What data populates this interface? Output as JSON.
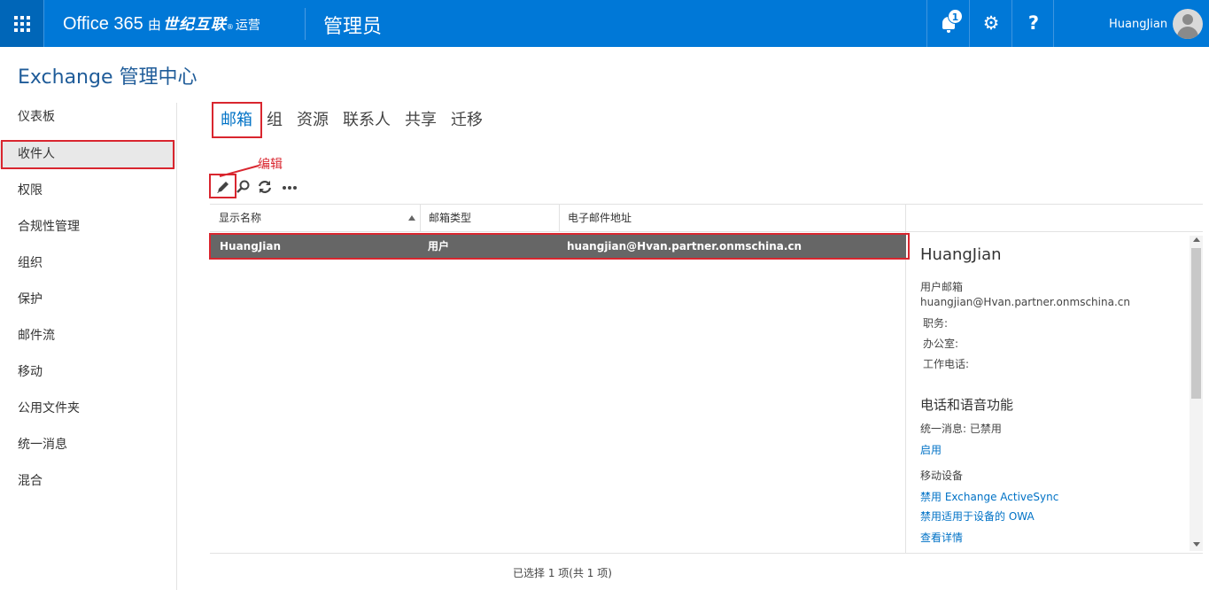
{
  "topbar": {
    "app_name": "Office 365",
    "by": "由",
    "partner_logo": "世纪互联",
    "registered_mark": "®",
    "operated": "运营",
    "section_title": "管理员",
    "notification_count": "1",
    "settings_icon": "gear-icon",
    "help_label": "?",
    "user_name": "HuangJian",
    "accent_color": "#0078d7"
  },
  "page": {
    "title": "Exchange 管理中心"
  },
  "sidebar": {
    "items": [
      {
        "label": "仪表板"
      },
      {
        "label": "收件人",
        "selected": true
      },
      {
        "label": "权限"
      },
      {
        "label": "合规性管理"
      },
      {
        "label": "组织"
      },
      {
        "label": "保护"
      },
      {
        "label": "邮件流"
      },
      {
        "label": "移动"
      },
      {
        "label": "公用文件夹"
      },
      {
        "label": "统一消息"
      },
      {
        "label": "混合"
      }
    ]
  },
  "tabs": [
    {
      "label": "邮箱",
      "active": true
    },
    {
      "label": "组"
    },
    {
      "label": "资源"
    },
    {
      "label": "联系人"
    },
    {
      "label": "共享"
    },
    {
      "label": "迁移"
    }
  ],
  "annotation": {
    "edit_label": "编辑",
    "highlight_color": "#d9262f"
  },
  "toolbar": {
    "icons": [
      "pencil-icon",
      "search-icon",
      "refresh-icon",
      "more-icon"
    ]
  },
  "table": {
    "headers": [
      "显示名称",
      "邮箱类型",
      "电子邮件地址"
    ],
    "sort_column": "显示名称",
    "rows": [
      {
        "name": "HuangJian",
        "type": "用户",
        "email": "huangjian@Hvan.partner.onmschina.cn",
        "selected": true
      }
    ],
    "status": "已选择 1 项(共 1 项)"
  },
  "details": {
    "name": "HuangJian",
    "mailbox_type": "用户邮箱",
    "email": "huangjian@Hvan.partner.onmschina.cn",
    "title_label": "职务:",
    "office_label": "办公室:",
    "phone_label": "工作电话:",
    "voice_section": "电话和语音功能",
    "um_status": "统一消息: 已禁用",
    "enable_link": "启用",
    "mobile_section": "移动设备",
    "disable_activesync_link": "禁用 Exchange ActiveSync",
    "disable_owa_link": "禁用适用于设备的 OWA",
    "view_details_link": "查看详情"
  }
}
